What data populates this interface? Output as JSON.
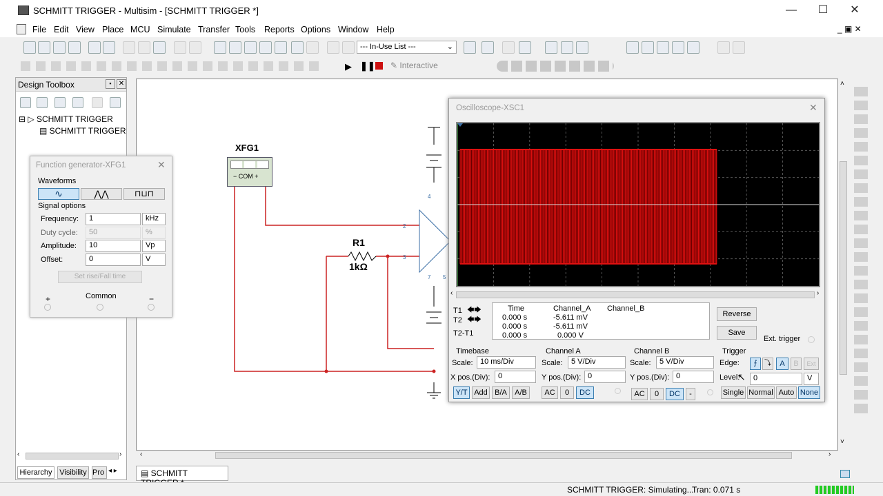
{
  "window": {
    "title": "SCHMITT TRIGGER - Multisim - [SCHMITT TRIGGER *]"
  },
  "menu": [
    "File",
    "Edit",
    "View",
    "Place",
    "MCU",
    "Simulate",
    "Transfer",
    "Tools",
    "Reports",
    "Options",
    "Window",
    "Help"
  ],
  "toolbar": {
    "inuse_list": "--- In-Use List ---",
    "interactive": "Interactive"
  },
  "toolbox": {
    "title": "Design Toolbox",
    "tree_root": "SCHMITT TRIGGER",
    "tree_child": "SCHMITT TRIGGER",
    "tabs": [
      "Hierarchy",
      "Visibility",
      "Pro"
    ]
  },
  "fgen": {
    "title": "Function generator-XFG1",
    "waveforms_label": "Waveforms",
    "signal_options_label": "Signal options",
    "rows": [
      {
        "label": "Frequency:",
        "value": "1",
        "unit": "kHz"
      },
      {
        "label": "Duty cycle:",
        "value": "50",
        "unit": "%"
      },
      {
        "label": "Amplitude:",
        "value": "10",
        "unit": "Vp"
      },
      {
        "label": "Offset:",
        "value": "0",
        "unit": "V"
      }
    ],
    "rise_fall_button": "Set rise/Fall time",
    "plus": "+",
    "common": "Common",
    "minus": "−"
  },
  "schematic": {
    "xfg_label": "XFG1",
    "com_label": "COM",
    "r1_label": "R1",
    "r1_value": "1kΩ",
    "pin2": "2",
    "pin3": "3",
    "pin4": "4",
    "pin7": "7",
    "pin5": "5"
  },
  "osc": {
    "title": "Oscilloscope-XSC1",
    "cursor_rows": [
      {
        "name": "T1",
        "time": "0.000 s",
        "cha": "-5.611 mV",
        "chb": ""
      },
      {
        "name": "T2",
        "time": "0.000 s",
        "cha": "-5.611 mV",
        "chb": ""
      },
      {
        "name": "T2-T1",
        "time": "0.000 s",
        "cha": "0.000 V",
        "chb": ""
      }
    ],
    "col_time": "Time",
    "col_cha": "Channel_A",
    "col_chb": "Channel_B",
    "reverse": "Reverse",
    "save": "Save",
    "ext_trigger": "Ext. trigger",
    "timebase": {
      "label": "Timebase",
      "scale_label": "Scale:",
      "scale": "10 ms/Div",
      "xpos_label": "X pos.(Div):",
      "xpos": "0",
      "buttons": [
        "Y/T",
        "Add",
        "B/A",
        "A/B"
      ]
    },
    "chA": {
      "label": "Channel A",
      "scale_label": "Scale:",
      "scale": "5  V/Div",
      "ypos_label": "Y pos.(Div):",
      "ypos": "0",
      "buttons": [
        "AC",
        "0",
        "DC"
      ]
    },
    "chB": {
      "label": "Channel B",
      "scale_label": "Scale:",
      "scale": "5  V/Div",
      "ypos_label": "Y pos.(Div):",
      "ypos": "0",
      "buttons": [
        "AC",
        "0",
        "DC",
        "-"
      ]
    },
    "trigger": {
      "label": "Trigger",
      "edge_label": "Edge:",
      "level_label": "Level:",
      "level": "0",
      "level_unit": "V",
      "edge_a": "A",
      "modes": [
        "Single",
        "Normal",
        "Auto",
        "None"
      ]
    }
  },
  "tabs": {
    "doc": "SCHMITT TRIGGER *"
  },
  "status": {
    "sim": "SCHMITT TRIGGER: Simulating...",
    "tran": "Tran: 0.071 s"
  },
  "colors": {
    "wire": "#cc2222",
    "trace": "#e01010",
    "accent": "#3c7fb1"
  }
}
